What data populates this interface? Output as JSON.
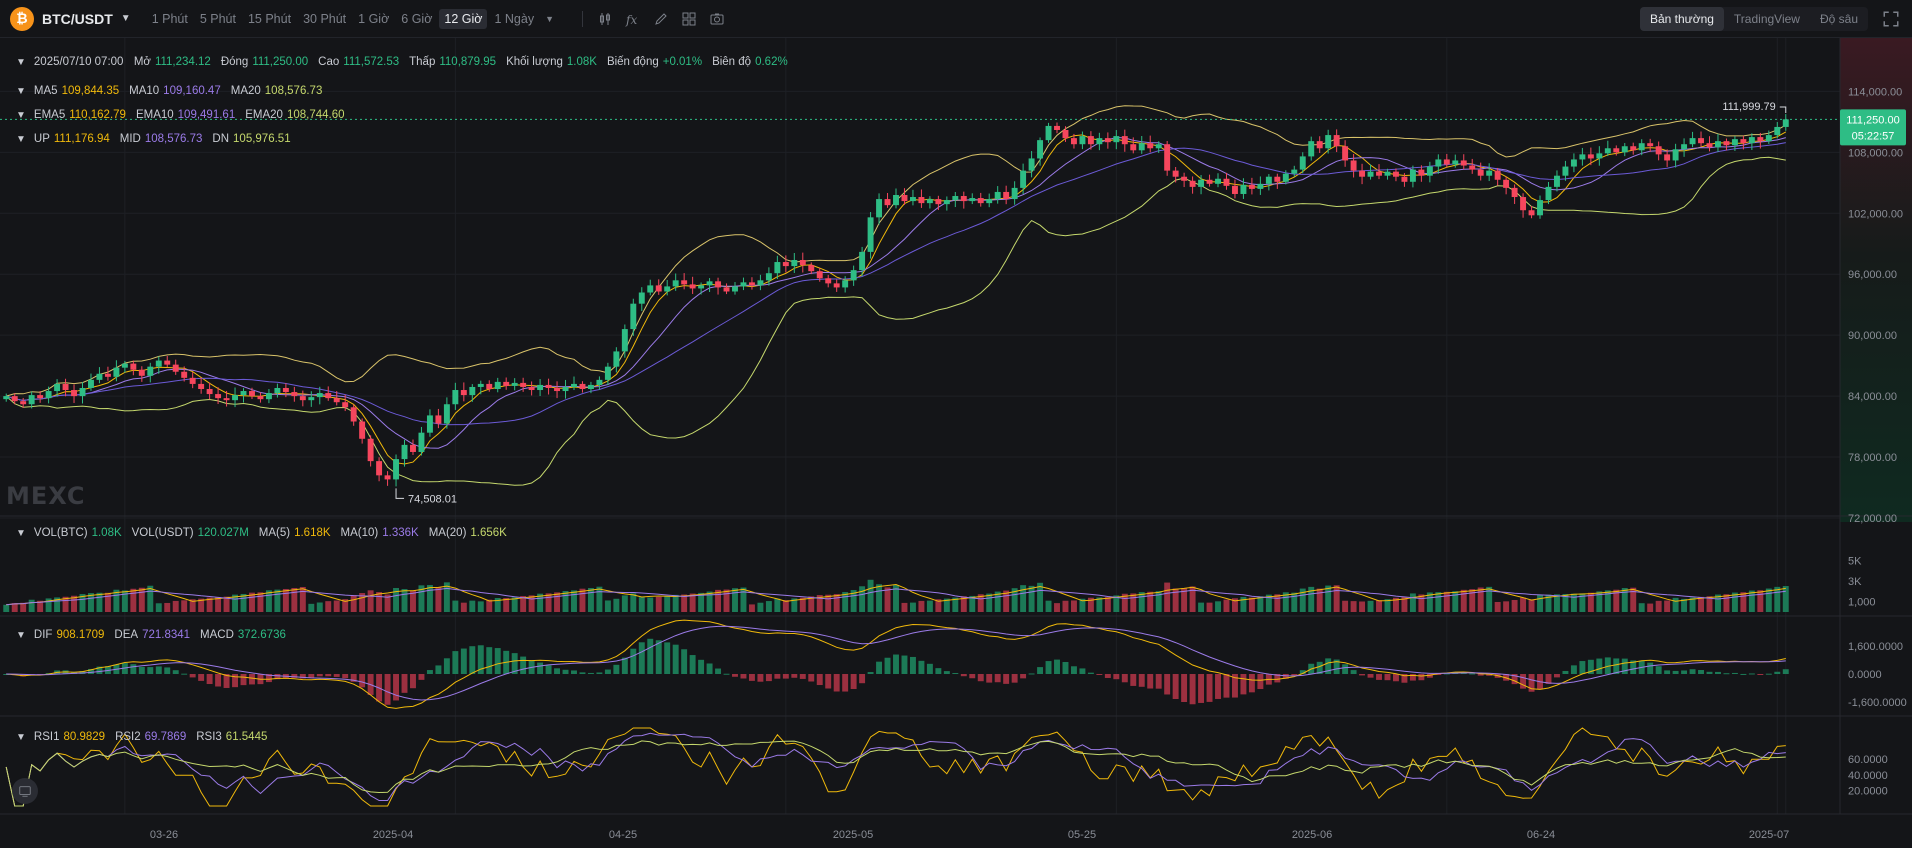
{
  "toolbar": {
    "coin_icon": "bitcoin-icon",
    "pair": "BTC/USDT",
    "intervals": [
      "1 Phút",
      "5 Phút",
      "15 Phút",
      "30 Phút",
      "1 Giờ",
      "6 Giờ",
      "12 Giờ",
      "1 Ngày"
    ],
    "active_interval": "12 Giờ",
    "tools": [
      "candle-type-icon",
      "indicator-fx-icon",
      "draw-pencil-icon",
      "layout-grid-icon",
      "camera-icon"
    ],
    "view_tabs": [
      "Bản thường",
      "TradingView",
      "Độ sâu"
    ],
    "active_view": "Bản thường"
  },
  "ohlc_legend": {
    "date": "2025/07/10 07:00",
    "open_label": "Mở",
    "open": "111,234.12",
    "close_label": "Đóng",
    "close": "111,250.00",
    "high_label": "Cao",
    "high": "111,572.53",
    "low_label": "Thấp",
    "low": "110,879.95",
    "volume_label": "Khối lượng",
    "volume": "1.08K",
    "change_label": "Biến động",
    "change": "+0.01%",
    "amplitude_label": "Biên độ",
    "amplitude": "0.62%"
  },
  "ma_legend": {
    "ma5_label": "MA5",
    "ma5": "109,844.35",
    "ma10_label": "MA10",
    "ma10": "109,160.47",
    "ma20_label": "MA20",
    "ma20": "108,576.73"
  },
  "ema_legend": {
    "ema5_label": "EMA5",
    "ema5": "110,162.79",
    "ema10_label": "EMA10",
    "ema10": "109,491.61",
    "ema20_label": "EMA20",
    "ema20": "108,744.60"
  },
  "boll_legend": {
    "up_label": "UP",
    "up": "111,176.94",
    "mid_label": "MID",
    "mid": "108,576.73",
    "dn_label": "DN",
    "dn": "105,976.51"
  },
  "vol_legend": {
    "vol_btc_label": "VOL(BTC)",
    "vol_btc": "1.08K",
    "vol_usdt_label": "VOL(USDT)",
    "vol_usdt": "120.027M",
    "ma5_label": "MA(5)",
    "ma5": "1.618K",
    "ma10_label": "MA(10)",
    "ma10": "1.336K",
    "ma20_label": "MA(20)",
    "ma20": "1.656K"
  },
  "macd_legend": {
    "dif_label": "DIF",
    "dif": "908.1709",
    "dea_label": "DEA",
    "dea": "721.8341",
    "macd_label": "MACD",
    "macd": "372.6736"
  },
  "rsi_legend": {
    "rsi1_label": "RSI1",
    "rsi1": "80.9829",
    "rsi2_label": "RSI2",
    "rsi2": "69.7869",
    "rsi3_label": "RSI3",
    "rsi3": "61.5445"
  },
  "price_axis": [
    "114,000.00",
    "108,000.00",
    "102,000.00",
    "96,000.00",
    "90,000.00",
    "84,000.00",
    "78,000.00",
    "72,000.00"
  ],
  "current_price": "111,250.00",
  "countdown": "05:22:57",
  "high_marker": "111,999.79",
  "low_marker": "74,508.01",
  "volume_axis": [
    "5K",
    "3K",
    "1,000"
  ],
  "macd_axis": [
    "1,600.0000",
    "0.0000",
    "-1,600.0000"
  ],
  "rsi_axis": [
    "60.0000",
    "40.0000",
    "20.0000"
  ],
  "date_axis": [
    "03-26",
    "2025-04",
    "04-25",
    "2025-05",
    "05-25",
    "2025-06",
    "06-24",
    "2025-07"
  ],
  "watermark": "MEXC",
  "colors": {
    "up": "#2ebd85",
    "down": "#f6465d",
    "ma5": "#f0b90b",
    "ma10": "#9b7be8",
    "ma20": "#c5d86d",
    "boll": "#d9c36a"
  },
  "chart_data": {
    "type": "candlestick",
    "interval": "12 Giờ",
    "y_range": [
      72000,
      116500
    ],
    "close_series": [
      84000,
      83500,
      83200,
      84100,
      83800,
      84500,
      85200,
      84600,
      84000,
      84800,
      85600,
      86200,
      85900,
      86800,
      87200,
      86600,
      86000,
      86900,
      87500,
      87100,
      86400,
      85800,
      85200,
      84700,
      84200,
      83800,
      83600,
      84100,
      84500,
      84000,
      83700,
      84300,
      84800,
      84400,
      84000,
      83600,
      83900,
      84300,
      83800,
      83400,
      82900,
      81500,
      79800,
      77600,
      76200,
      75800,
      77800,
      79200,
      78500,
      80400,
      82100,
      81300,
      83200,
      84600,
      84100,
      84900,
      85200,
      84700,
      85400,
      85000,
      85300,
      84900,
      84600,
      85100,
      84800,
      84500,
      84900,
      85200,
      84700,
      85100,
      85600,
      86900,
      88400,
      90600,
      93100,
      94200,
      94900,
      94300,
      94800,
      95400,
      95000,
      94600,
      94900,
      95300,
      94700,
      94300,
      94800,
      95200,
      94900,
      95400,
      96100,
      97200,
      96800,
      97400,
      96900,
      96300,
      95600,
      95100,
      94700,
      95400,
      96400,
      98200,
      101600,
      103400,
      102800,
      103800,
      103200,
      103600,
      103000,
      103400,
      102900,
      103300,
      103700,
      103200,
      103500,
      103000,
      103400,
      104100,
      103400,
      104500,
      106200,
      107400,
      109200,
      110600,
      110200,
      109400,
      108800,
      109600,
      108800,
      109400,
      109000,
      109600,
      108800,
      108200,
      108900,
      108400,
      108800,
      106200,
      105600,
      105200,
      104600,
      105300,
      104900,
      105400,
      104700,
      103900,
      104800,
      104400,
      104900,
      105600,
      105100,
      105900,
      106300,
      107600,
      109100,
      108400,
      109700,
      108600,
      107200,
      106200,
      105600,
      106100,
      105700,
      106100,
      105600,
      105100,
      106300,
      105700,
      106600,
      107300,
      106800,
      107200,
      106700,
      106300,
      105700,
      106200,
      105300,
      104500,
      103600,
      102300,
      101800,
      103300,
      104600,
      105700,
      106600,
      107300,
      107800,
      107400,
      107900,
      108400,
      108000,
      108600,
      108200,
      108900,
      108600,
      107800,
      107200,
      108300,
      108800,
      109400,
      108900,
      108500,
      109100,
      108700,
      109300,
      108900,
      109500,
      109100,
      109700,
      110500,
      111250
    ],
    "ma5_last": 109844.35,
    "ma10_last": 109160.47,
    "ma20_last": 108576.73,
    "boll_up_last": 111176.94,
    "boll_mid_last": 108576.73,
    "boll_dn_last": 105976.51
  }
}
